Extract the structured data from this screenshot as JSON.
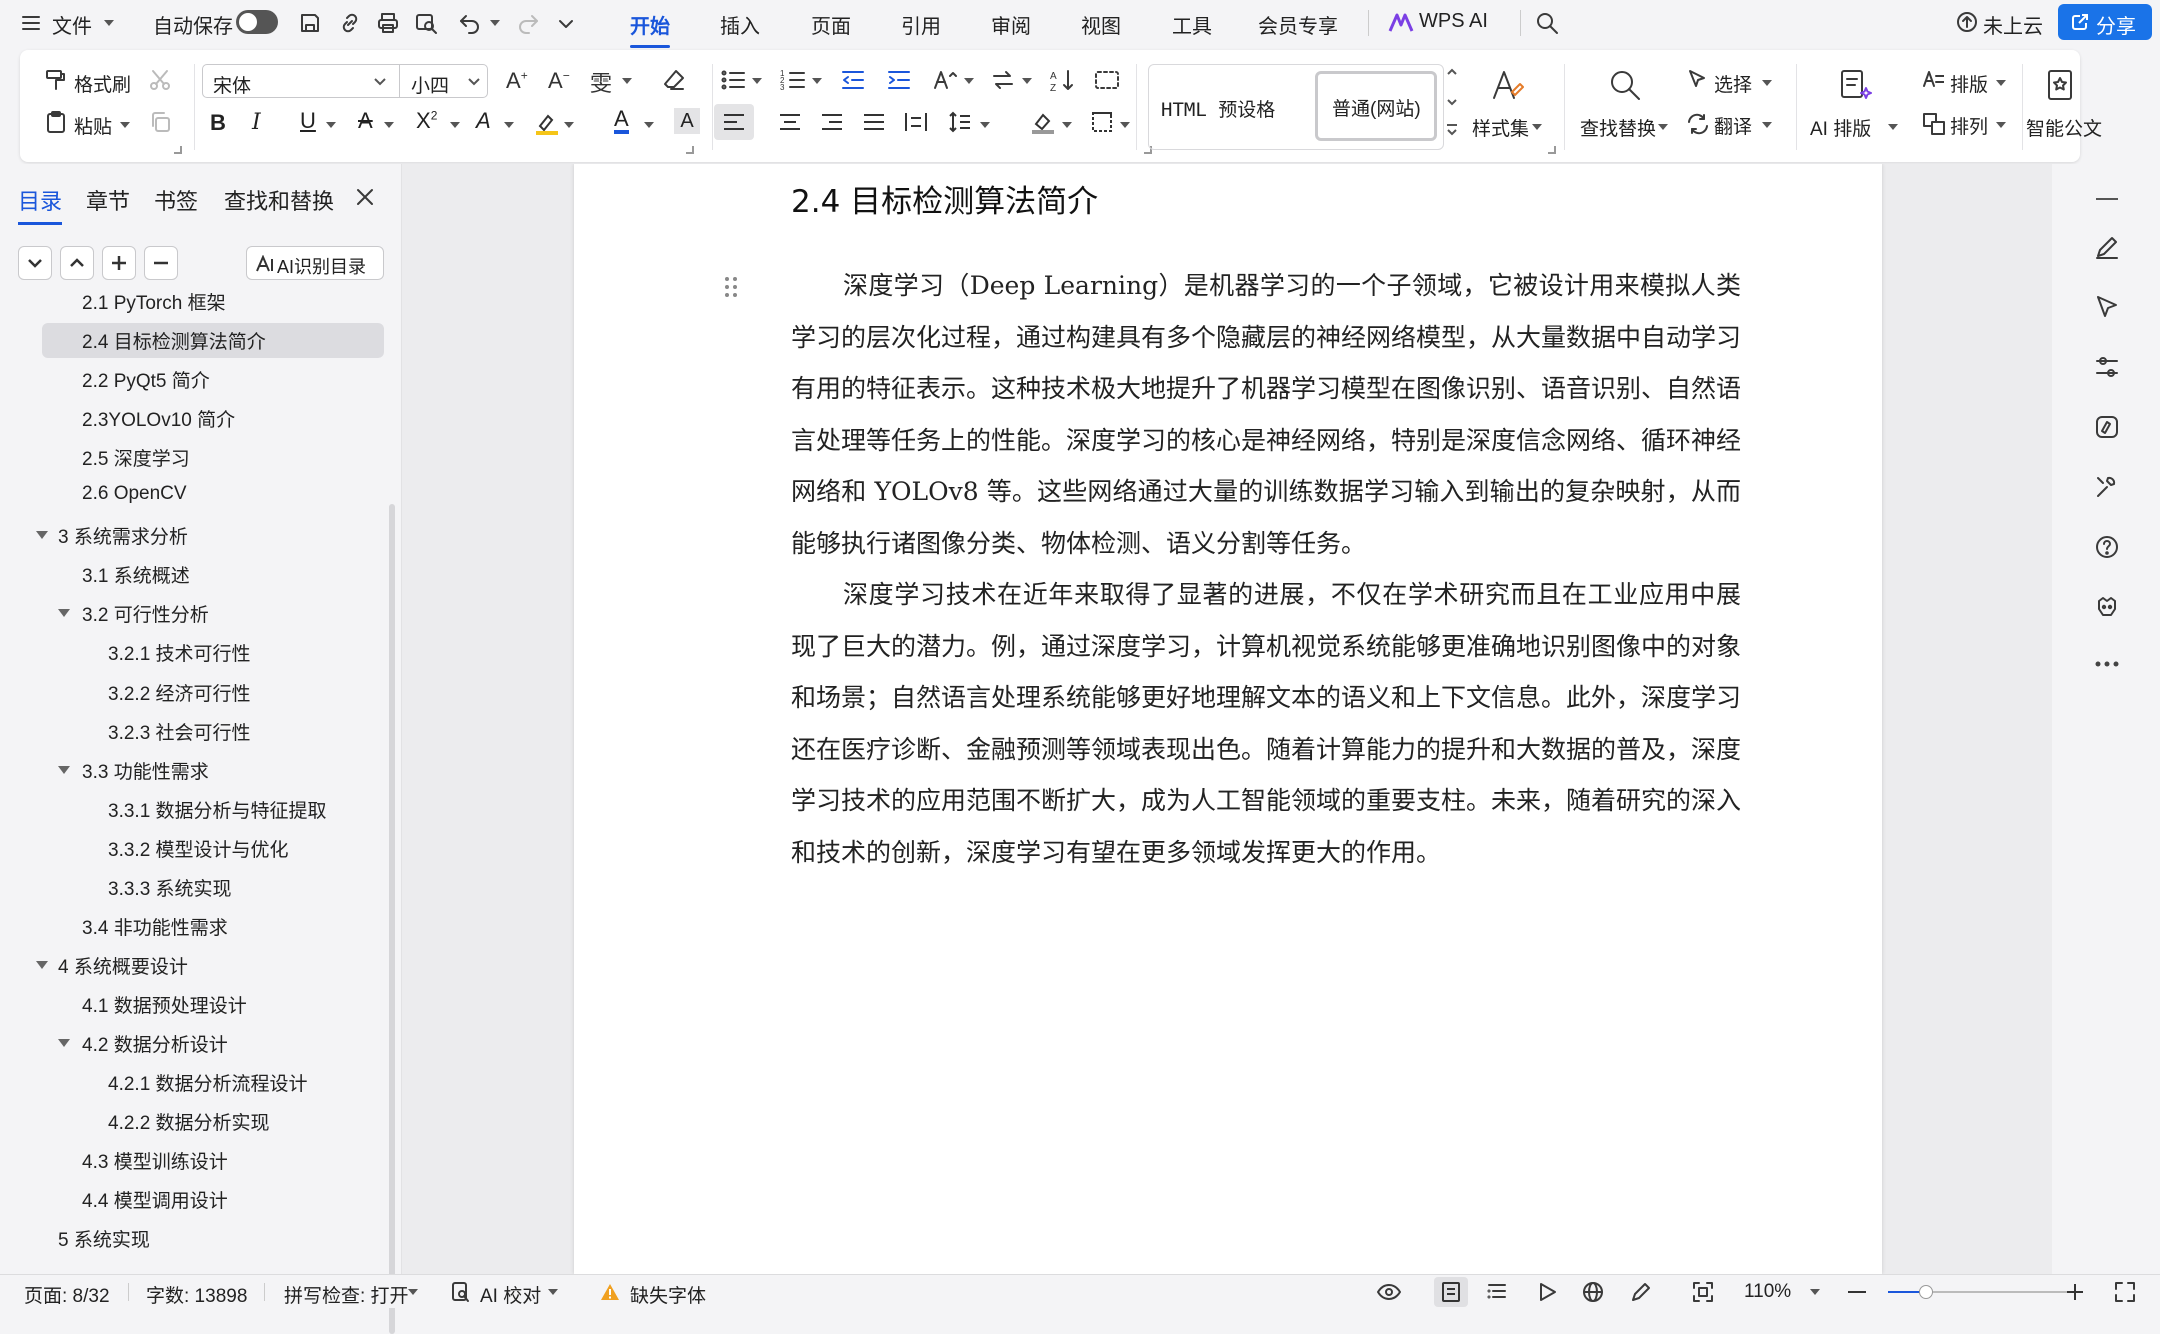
{
  "menu": {
    "file": "文件",
    "autosave": "自动保存",
    "tabs": [
      "开始",
      "插入",
      "页面",
      "引用",
      "审阅",
      "视图",
      "工具",
      "会员专享"
    ],
    "wps_ai": "WPS AI",
    "cloud": "未上云",
    "share": "分享"
  },
  "ribbon": {
    "format_painter": "格式刷",
    "paste": "粘贴",
    "font_name": "宋体",
    "font_size": "小四",
    "style_html": "HTML 预设格",
    "style_normal": "普通(网站)",
    "style_set": "样式集",
    "find_replace": "查找替换",
    "select": "选择",
    "translate": "翻译",
    "ai_layout": "AI 排版",
    "typeset": "排版",
    "arrange": "排列",
    "smart_doc": "智能公文",
    "font_color": "#1a56db",
    "highlight_color": "#f5c518"
  },
  "sidebar": {
    "tabs": [
      "目录",
      "章节",
      "书签",
      "查找和替换"
    ],
    "ai_toc": "AI识别目录",
    "toc": [
      {
        "label": "2.1 PyTorch 框架",
        "level": 2,
        "expand": false
      },
      {
        "label": "2.4 目标检测算法简介",
        "level": 2,
        "expand": false,
        "selected": true
      },
      {
        "label": "2.2 PyQt5 简介",
        "level": 2,
        "expand": false
      },
      {
        "label": "2.3YOLOv10 简介",
        "level": 2,
        "expand": false
      },
      {
        "label": "2.5  深度学习",
        "level": 2,
        "expand": false
      },
      {
        "label": "2.6 OpenCV",
        "level": 2,
        "expand": false
      },
      {
        "label": "3  系统需求分析",
        "level": 1,
        "expand": true
      },
      {
        "label": "3.1  系统概述",
        "level": 2,
        "expand": false
      },
      {
        "label": "3.2  可行性分析",
        "level": 2,
        "expand": true
      },
      {
        "label": "3.2.1  技术可行性",
        "level": 3,
        "expand": false
      },
      {
        "label": "3.2.2  经济可行性",
        "level": 3,
        "expand": false
      },
      {
        "label": "3.2.3  社会可行性",
        "level": 3,
        "expand": false
      },
      {
        "label": "3.3  功能性需求",
        "level": 2,
        "expand": true
      },
      {
        "label": "3.3.1  数据分析与特征提取",
        "level": 3,
        "expand": false
      },
      {
        "label": "3.3.2  模型设计与优化",
        "level": 3,
        "expand": false
      },
      {
        "label": "3.3.3  系统实现",
        "level": 3,
        "expand": false
      },
      {
        "label": "3.4  非功能性需求",
        "level": 2,
        "expand": false
      },
      {
        "label": "4  系统概要设计",
        "level": 1,
        "expand": true
      },
      {
        "label": "4.1  数据预处理设计",
        "level": 2,
        "expand": false
      },
      {
        "label": "4.2  数据分析设计",
        "level": 2,
        "expand": true
      },
      {
        "label": "4.2.1  数据分析流程设计",
        "level": 3,
        "expand": false
      },
      {
        "label": "4.2.2  数据分析实现",
        "level": 3,
        "expand": false
      },
      {
        "label": "4.3  模型训练设计",
        "level": 2,
        "expand": false
      },
      {
        "label": "4.4  模型调用设计",
        "level": 2,
        "expand": false
      },
      {
        "label": "5  系统实现",
        "level": 1,
        "expand": false
      }
    ]
  },
  "document": {
    "heading": "2.4 目标检测算法简介",
    "paragraphs": [
      "深度学习（Deep Learning）是机器学习的一个子领域，它被设计用来模拟人类学习的层次化过程，通过构建具有多个隐藏层的神经网络模型，从大量数据中自动学习有用的特征表示。这种技术极大地提升了机器学习模型在图像识别、语音识别、自然语言处理等任务上的性能。深度学习的核心是神经网络，特别是深度信念网络、循环神经网络和 YOLOv8 等。这些网络通过大量的训练数据学习输入到输出的复杂映射，从而能够执行诸图像分类、物体检测、语义分割等任务。",
      "深度学习技术在近年来取得了显著的进展，不仅在学术研究而且在工业应用中展现了巨大的潜力。例，通过深度学习，计算机视觉系统能够更准确地识别图像中的对象和场景；自然语言处理系统能够更好地理解文本的语义和上下文信息。此外，深度学习还在医疗诊断、金融预测等领域表现出色。随着计算能力的提升和大数据的普及，深度学习技术的应用范围不断扩大，成为人工智能领域的重要支柱。未来，随着研究的深入和技术的创新，深度学习有望在更多领域发挥更大的作用。"
    ]
  },
  "status": {
    "page": "页面: 8/32",
    "words": "字数: 13898",
    "spell": "拼写检查: 打开",
    "ai_check": "AI 校对",
    "missing_font": "缺失字体",
    "zoom": "110%"
  }
}
